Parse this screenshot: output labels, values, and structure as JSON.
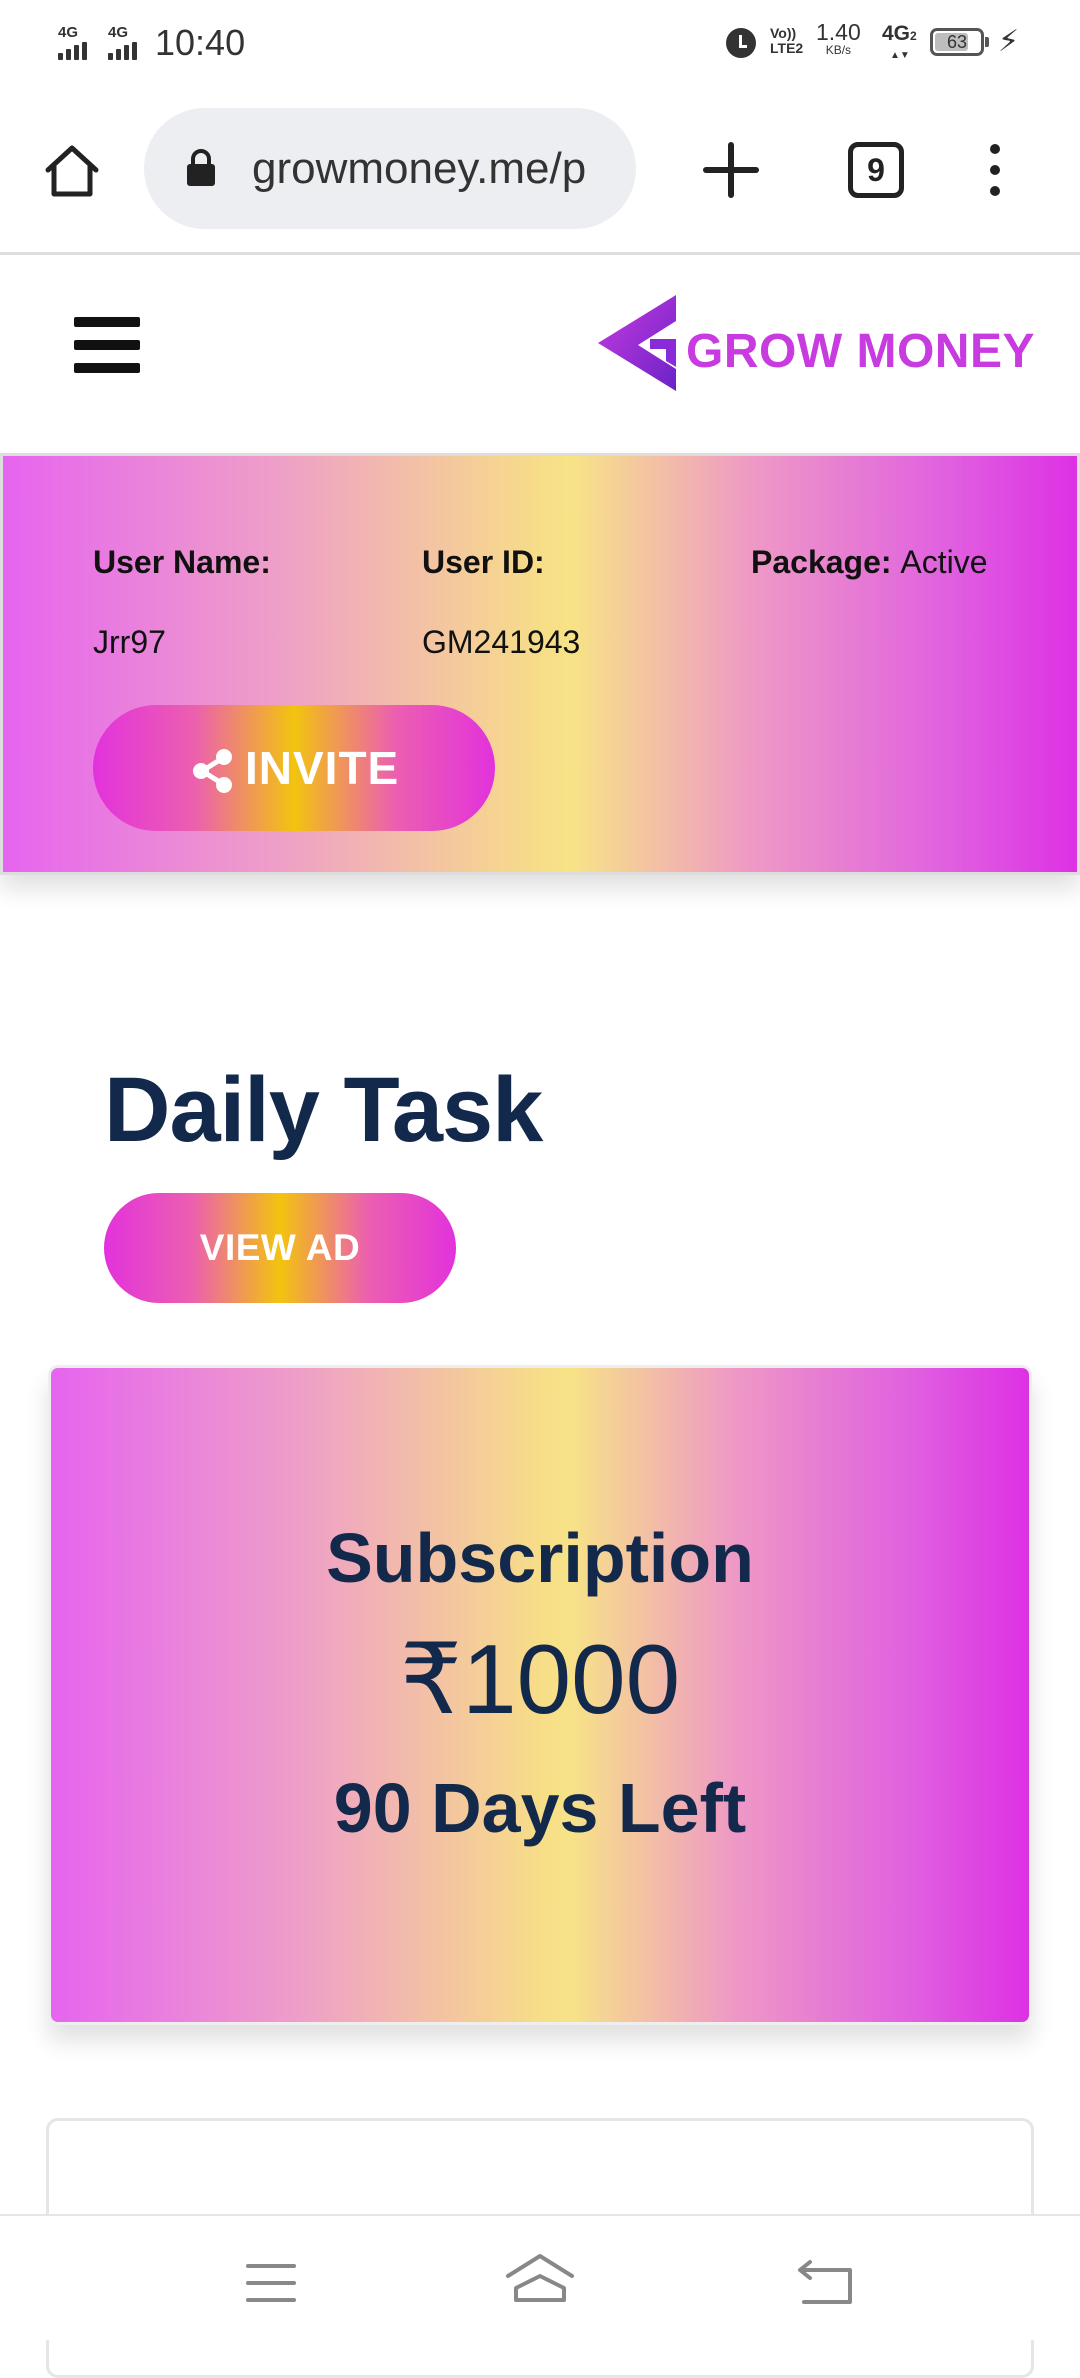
{
  "status_bar": {
    "network_1": "4G",
    "network_2": "4G",
    "time": "10:40",
    "volte_top": "Vo))",
    "volte_sub": "LTE2",
    "speed_value": "1.40",
    "speed_unit": "KB/s",
    "network_3": "4G",
    "network_3_sub": "2",
    "battery_level": "63",
    "icons": [
      "alarm-icon",
      "charging-icon"
    ]
  },
  "browser": {
    "url": "growmoney.me/p",
    "tab_count": "9",
    "icons": [
      "home-icon",
      "lock-icon",
      "new-tab-icon",
      "tabs-icon",
      "menu-dots-icon"
    ]
  },
  "site_header": {
    "brand_name": "GROW MONEY",
    "brand_color": "#c73be0",
    "icons": [
      "hamburger-menu-icon",
      "grow-money-logo-icon"
    ]
  },
  "user_info": {
    "username_label": "User Name:",
    "username_value": "Jrr97",
    "userid_label": "User ID:",
    "userid_value": "GM241943",
    "package_label": "Package:",
    "package_value": "Active",
    "invite_label": "INVITE",
    "icons": [
      "share-icon"
    ]
  },
  "daily_task": {
    "title": "Daily Task",
    "view_ad_label": "VIEW AD",
    "title_color": "#13294b"
  },
  "subscription": {
    "title": "Subscription",
    "price": "₹1000",
    "days_left": "90 Days Left"
  },
  "bottom_nav": {
    "icons": [
      "nav-menu-icon",
      "nav-home-icon",
      "nav-back-icon"
    ]
  }
}
